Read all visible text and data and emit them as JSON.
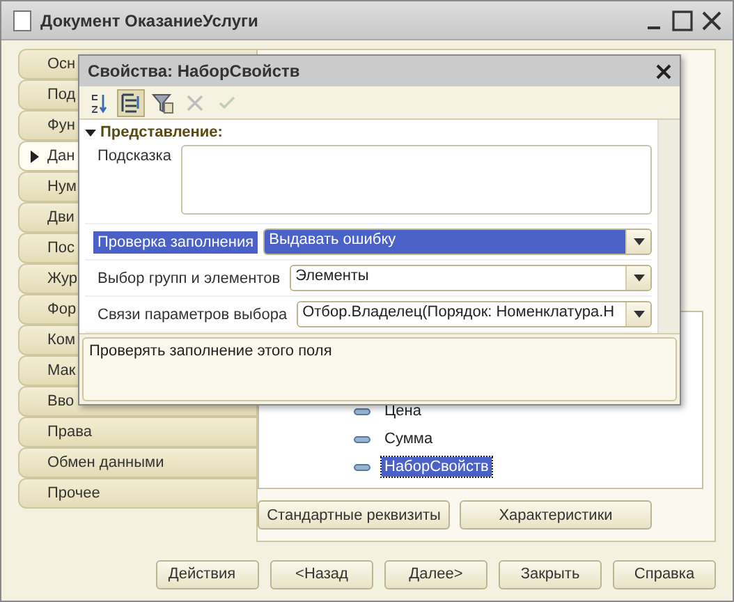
{
  "window": {
    "title": "Документ ОказаниеУслуги"
  },
  "tabs": [
    {
      "label": "Осн",
      "selected": false
    },
    {
      "label": "Под",
      "selected": false
    },
    {
      "label": "Фун",
      "selected": false
    },
    {
      "label": "Дан",
      "selected": true
    },
    {
      "label": "Нум",
      "selected": false
    },
    {
      "label": "Дви",
      "selected": false
    },
    {
      "label": "Пос",
      "selected": false
    },
    {
      "label": "Жур",
      "selected": false
    },
    {
      "label": "Фор",
      "selected": false
    },
    {
      "label": "Ком",
      "selected": false
    },
    {
      "label": "Мак",
      "selected": false
    },
    {
      "label": "Вво",
      "selected": false
    },
    {
      "label": "Права",
      "selected": false
    },
    {
      "label": "Обмен данными",
      "selected": false
    },
    {
      "label": "Прочее",
      "selected": false
    }
  ],
  "tree": {
    "items": [
      {
        "label": "Цена",
        "selected": false
      },
      {
        "label": "Сумма",
        "selected": false
      },
      {
        "label": "НаборСвойств",
        "selected": true
      }
    ]
  },
  "panel_buttons": [
    "Стандартные реквизиты",
    "Характеристики"
  ],
  "footer_buttons": [
    {
      "label": "Действия",
      "kind": "menu"
    },
    {
      "label": "<Назад",
      "kind": "plain"
    },
    {
      "label": "Далее>",
      "kind": "plain"
    },
    {
      "label": "Закрыть",
      "kind": "plain"
    },
    {
      "label": "Справка",
      "kind": "plain"
    }
  ],
  "palette": {
    "title": "Свойства: НаборСвойств",
    "toolbar": [
      {
        "kind": "sort",
        "selected": false,
        "disabled": false
      },
      {
        "kind": "categories",
        "selected": true,
        "disabled": false
      },
      {
        "kind": "filter",
        "selected": false,
        "disabled": false
      },
      {
        "kind": "delete",
        "selected": false,
        "disabled": true
      },
      {
        "kind": "apply",
        "selected": false,
        "disabled": true
      }
    ],
    "section": {
      "label": "Представление:",
      "expanded": true
    },
    "rows": [
      {
        "kind": "textarea",
        "label": "Подсказка",
        "selected": false
      },
      {
        "kind": "combo",
        "label": "Проверка заполнения",
        "value": "Выдавать ошибку",
        "selected": true
      },
      {
        "kind": "combo",
        "label": "Выбор групп и элементов",
        "value": "Элементы",
        "selected": false
      },
      {
        "kind": "combo",
        "label": "Связи параметров выбора",
        "value": "Отбор.Владелец(Порядок: Номенклатура.Н",
        "selected": false
      }
    ],
    "description": "Проверять заполнение этого поля"
  }
}
